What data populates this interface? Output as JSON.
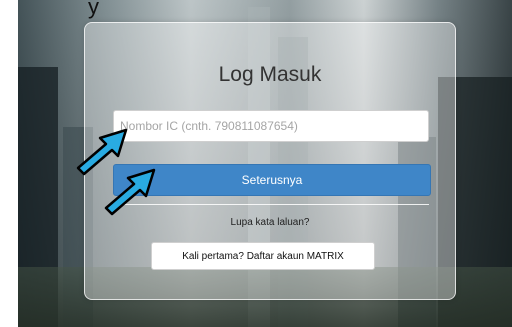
{
  "login": {
    "title": "Log Masuk",
    "ic_placeholder": "Nombor IC (cnth. 790811087654)",
    "next_label": "Seterusnya",
    "forgot_label": "Lupa kata laluan?",
    "register_label": "Kali pertama? Daftar akaun MATRIX"
  },
  "annotations": {
    "top_glyph": "y",
    "arrow_color": "#29abe2",
    "arrow_icon": "annotation-arrow-icon"
  },
  "colors": {
    "primary_button": "#3f86c8"
  }
}
